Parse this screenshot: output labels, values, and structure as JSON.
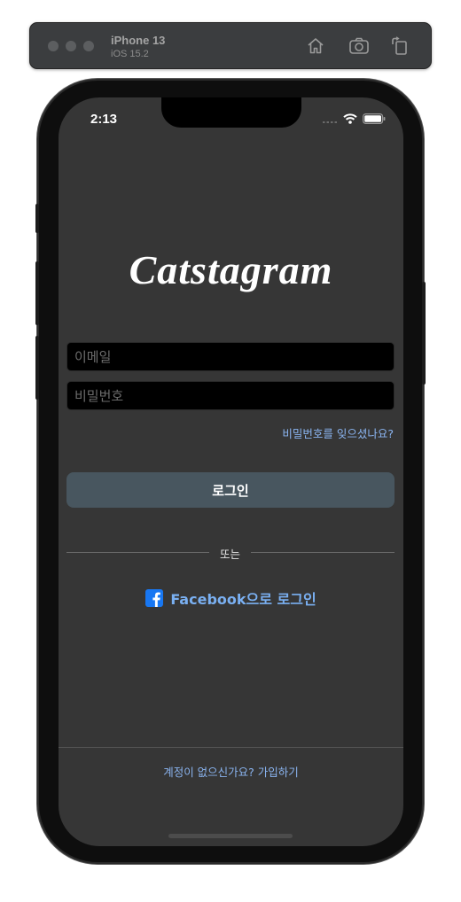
{
  "simulator": {
    "device_name": "iPhone 13",
    "os_version": "iOS 15.2",
    "home_icon": "home-icon",
    "screenshot_icon": "camera-icon",
    "rotate_icon": "rotate-icon"
  },
  "status_bar": {
    "time": "2:13",
    "icons": [
      "cellular-icon",
      "wifi-icon",
      "battery-icon"
    ]
  },
  "app": {
    "logo": "Catstagram",
    "email_placeholder": "이메일",
    "password_placeholder": "비밀번호",
    "forgot_password": "비밀번호를 잊으셨나요?",
    "login_button": "로그인",
    "or_divider": "또는",
    "facebook_login": "Facebook으로 로그인",
    "facebook_icon": "facebook-icon",
    "signup_prompt": "계정이 없으신가요? 가입하기"
  },
  "colors": {
    "background": "#363636",
    "login_button": "#48565f",
    "link": "#8ab4f0",
    "facebook": "#1877f2"
  }
}
